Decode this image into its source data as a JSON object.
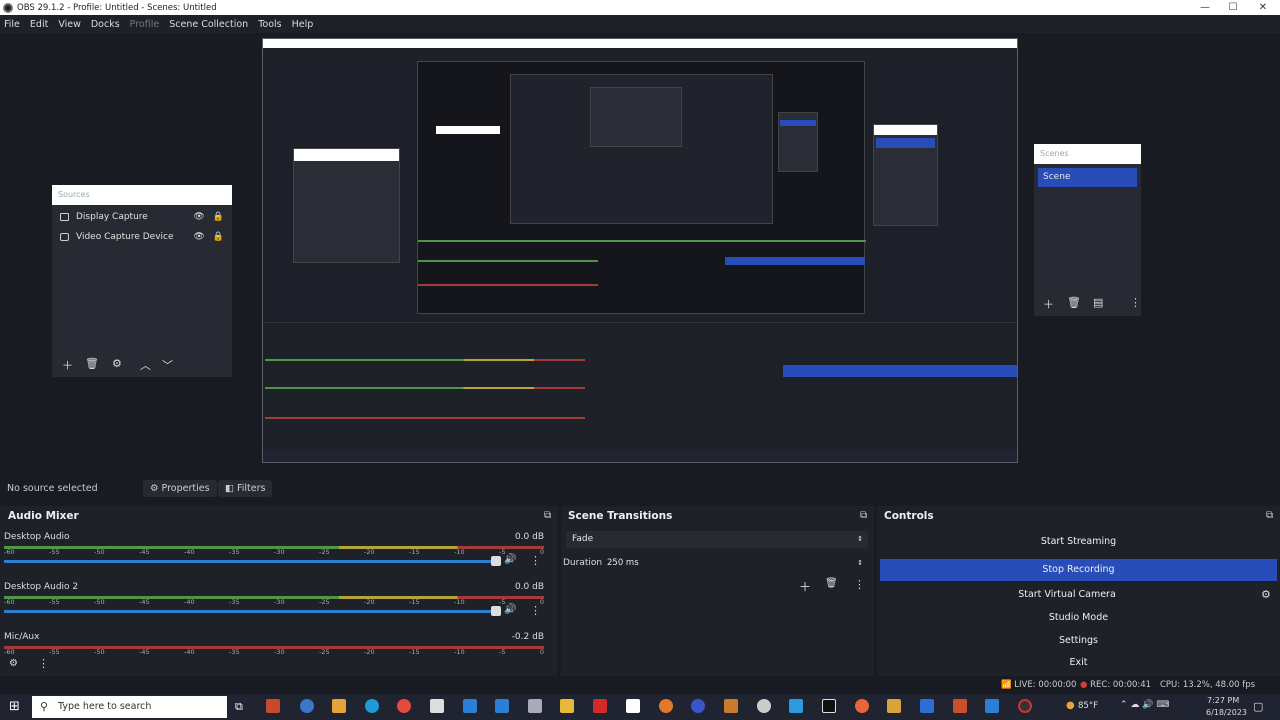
{
  "window": {
    "title": "OBS 29.1.2 - Profile: Untitled - Scenes: Untitled",
    "minimize": "—",
    "maximize": "☐",
    "close": "✕"
  },
  "menu": {
    "items": [
      "File",
      "Edit",
      "View",
      "Docks",
      "Profile",
      "Scene Collection",
      "Tools",
      "Help"
    ]
  },
  "sources": {
    "header": "Sources",
    "items": [
      {
        "label": "Display Capture"
      },
      {
        "label": "Video Capture Device"
      }
    ]
  },
  "scenes": {
    "header": "Scenes",
    "items": [
      {
        "label": "Scene"
      }
    ]
  },
  "source_bar": {
    "no_source": "No source selected",
    "properties": "Properties",
    "filters": "Filters"
  },
  "audio_mixer": {
    "title": "Audio Mixer",
    "ticks": [
      "-60",
      "-55",
      "-50",
      "-45",
      "-40",
      "-35",
      "-30",
      "-25",
      "-20",
      "-15",
      "-10",
      "-5",
      "0"
    ],
    "channels": [
      {
        "name": "Desktop Audio",
        "db": "0.0 dB"
      },
      {
        "name": "Desktop Audio 2",
        "db": "0.0 dB"
      },
      {
        "name": "Mic/Aux",
        "db": "-0.2 dB"
      }
    ]
  },
  "scene_transitions": {
    "title": "Scene Transitions",
    "transition": "Fade",
    "duration_label": "Duration",
    "duration_value": "250 ms"
  },
  "controls": {
    "title": "Controls",
    "buttons": [
      "Start Streaming",
      "Stop Recording",
      "Start Virtual Camera",
      "Studio Mode",
      "Settings",
      "Exit"
    ]
  },
  "status": {
    "live": "LIVE: 00:00:00",
    "rec": "REC: 00:00:41",
    "cpu": "CPU: 13.2%, 48.00 fps"
  },
  "taskbar": {
    "search_placeholder": "Type here to search",
    "temp": "85°F",
    "time": "7:27 PM",
    "date": "6/18/2023"
  },
  "colors": {
    "accent": "#284cb8",
    "rec": "#d23c3c",
    "bg": "#181b22"
  }
}
